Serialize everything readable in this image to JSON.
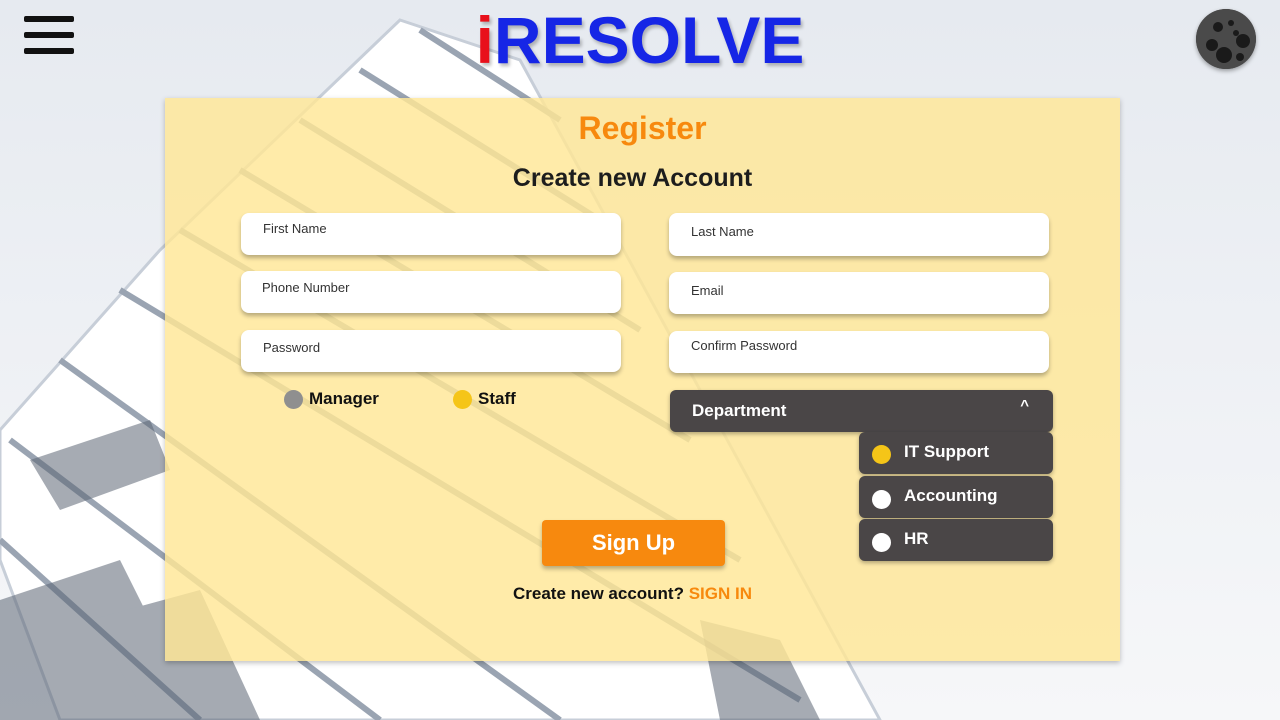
{
  "header": {
    "logo_i": "i",
    "logo_rest": "RESOLVE"
  },
  "form": {
    "title": "Register",
    "subtitle": "Create new Account",
    "fields": {
      "first_name": "First Name",
      "last_name": "Last Name",
      "phone": "Phone Number",
      "email": "Email",
      "password": "Password",
      "confirm_password": "Confirm Password"
    },
    "roles": [
      {
        "label": "Manager",
        "color": "#8f8f8f",
        "selected": false
      },
      {
        "label": "Staff",
        "color": "#f5c518",
        "selected": true
      }
    ],
    "department": {
      "label": "Department",
      "caret": "^",
      "options": [
        {
          "label": "IT Support",
          "selected": true,
          "color": "#f5c518"
        },
        {
          "label": "Accounting",
          "selected": false,
          "color": "#ffffff"
        },
        {
          "label": "HR",
          "selected": false,
          "color": "#ffffff"
        }
      ]
    },
    "signup_label": "Sign Up",
    "footer_text": "Create new account?",
    "signin_link": "SIGN IN"
  },
  "colors": {
    "accent_orange": "#f7890e",
    "logo_blue": "#1626e6",
    "logo_red": "#e8101b",
    "panel": "#ffe696",
    "dropdown": "#4a4647"
  }
}
